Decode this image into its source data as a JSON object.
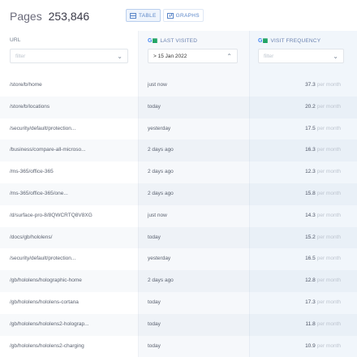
{
  "header": {
    "title": "Pages",
    "count": "253,846",
    "view_tabs": [
      {
        "label": "TABLE",
        "icon": "table-icon",
        "active": true
      },
      {
        "label": "GRAPHS",
        "icon": "graph-icon",
        "active": false
      }
    ]
  },
  "columns": {
    "url": {
      "label": "URL",
      "filter_placeholder": "filter"
    },
    "last_visited": {
      "label": "LAST VISITED",
      "filter_value": "> 15 Jan 2022"
    },
    "visit_frequency": {
      "label": "VISIT FREQUENCY",
      "filter_placeholder": "filter"
    }
  },
  "unit_label": "per month",
  "rows": [
    {
      "url": "/store/b/home",
      "when": "just now",
      "freq": "37.3"
    },
    {
      "url": "/store/b/locations",
      "when": "today",
      "freq": "20.2"
    },
    {
      "url": "/security/default/protection...",
      "when": "yesterday",
      "freq": "17.5"
    },
    {
      "url": "/business/compare-all-microso...",
      "when": "2 days ago",
      "freq": "16.3"
    },
    {
      "url": "/ms-365/office-365",
      "when": "2 days ago",
      "freq": "12.3"
    },
    {
      "url": "/ms-365/office-365/one...",
      "when": "2 days ago",
      "freq": "15.8"
    },
    {
      "url": "/d/surface-pro-8/8QWCRTQ8V8XG",
      "when": "just now",
      "freq": "14.3"
    },
    {
      "url": "/docs/gb/hololens/",
      "when": "today",
      "freq": "15.2"
    },
    {
      "url": "/security/default/protection...",
      "when": "yesterday",
      "freq": "16.5"
    },
    {
      "url": "/gb/hololens/holographic-home",
      "when": "2 days ago",
      "freq": "12.8"
    },
    {
      "url": "/gb/hololens/hololens-cortana",
      "when": "today",
      "freq": "17.3"
    },
    {
      "url": "/gb/hololens/hololens2-holograp...",
      "when": "today",
      "freq": "11.8"
    },
    {
      "url": "/gb/hololens/hololens2-charging",
      "when": "today",
      "freq": "10.9"
    }
  ]
}
